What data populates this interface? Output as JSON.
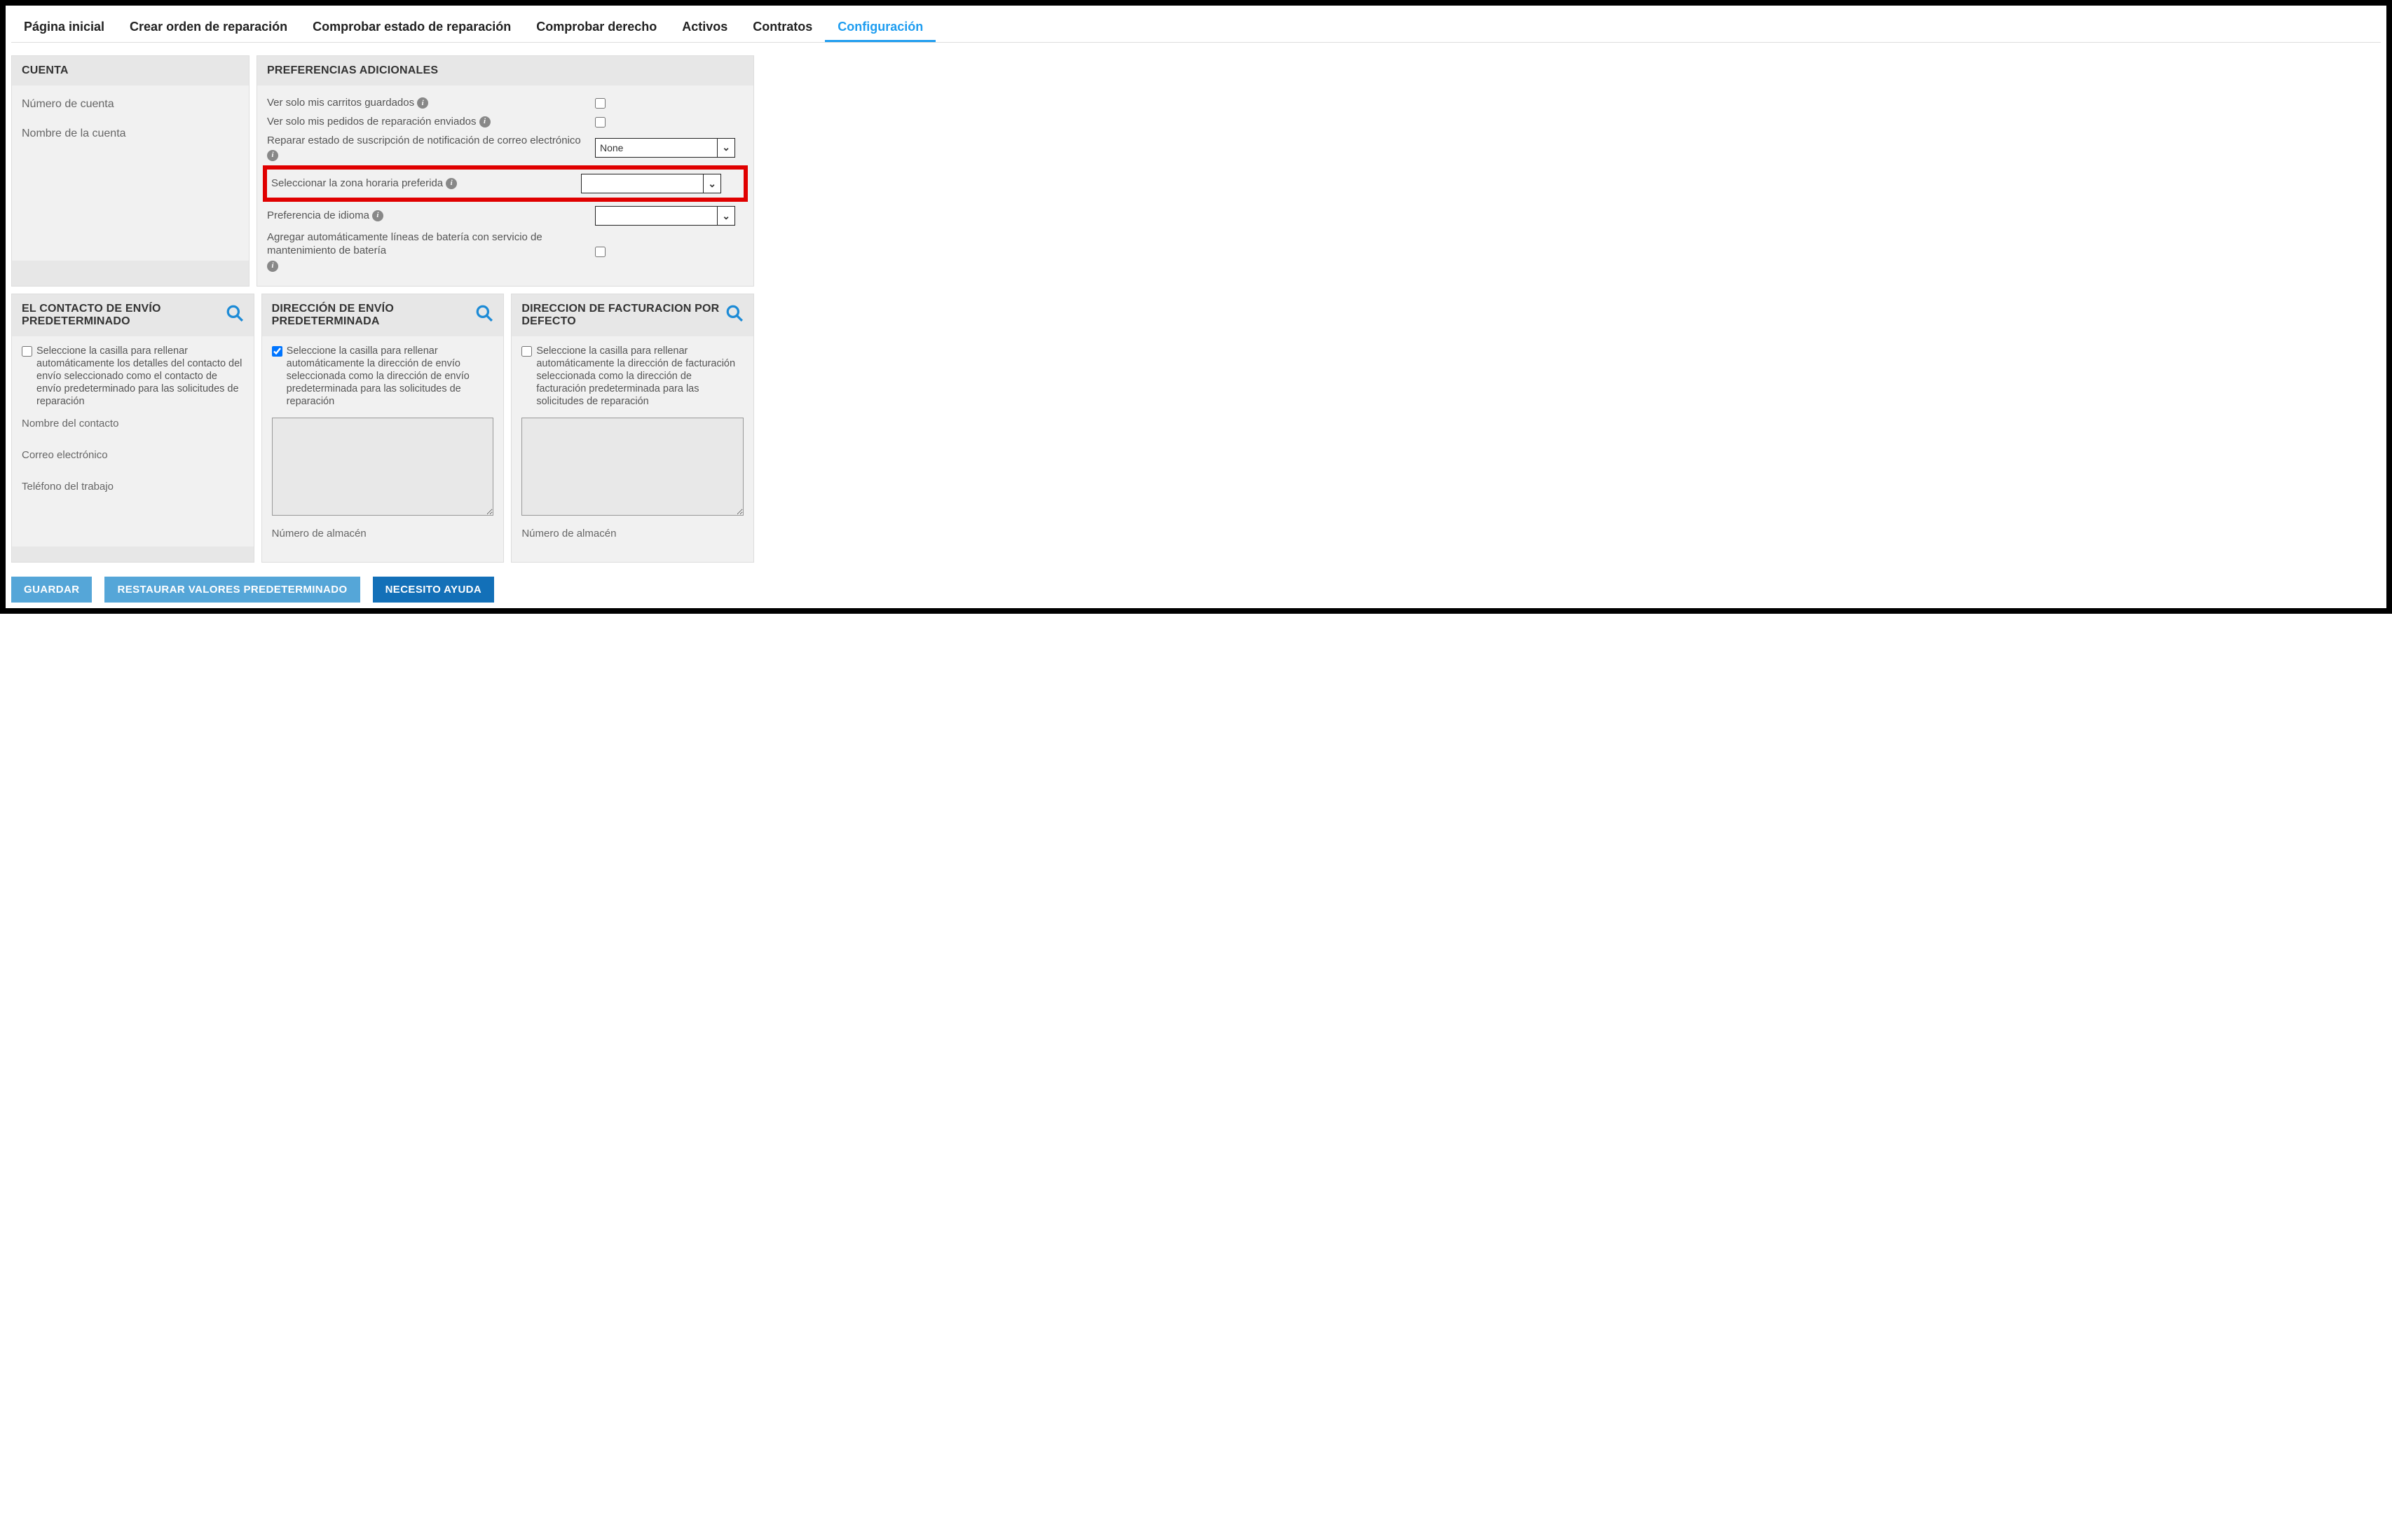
{
  "tabs": {
    "home": "Página inicial",
    "create": "Crear orden de reparación",
    "check_status": "Comprobar estado de reparación",
    "check_entitle": "Comprobar derecho",
    "assets": "Activos",
    "contracts": "Contratos",
    "config": "Configuración"
  },
  "account": {
    "title": "CUENTA",
    "number_label": "Número de cuenta",
    "name_label": "Nombre de la cuenta"
  },
  "prefs": {
    "title": "PREFERENCIAS ADICIONALES",
    "row1": "Ver solo mis carritos guardados",
    "row2": "Ver solo mis pedidos de reparación enviados",
    "row3": "Reparar estado de suscripción de notificación de correo electrónico",
    "row3_value": "None",
    "row4": "Seleccionar la zona horaria preferida",
    "row4_value": "",
    "row5": "Preferencia de idioma",
    "row5_value": "",
    "row6": "Agregar automáticamente líneas de batería con servicio de mantenimiento de batería"
  },
  "ship_contact": {
    "title": "EL CONTACTO DE ENVÍO PREDETERMINADO",
    "checkbox": "Seleccione la casilla para rellenar automáticamente los detalles del contacto del envío seleccionado como el contacto de envío predeterminado para las solicitudes de reparación",
    "contact_name": "Nombre del contacto",
    "email": "Correo electrónico",
    "phone": "Teléfono del trabajo"
  },
  "ship_addr": {
    "title": "DIRECCIÓN DE ENVÍO PREDETERMINADA",
    "checkbox": "Seleccione la casilla para rellenar automáticamente la dirección de envío seleccionada como la dirección de envío predeterminada para las solicitudes de reparación",
    "warehouse": "Número de almacén"
  },
  "bill_addr": {
    "title": "DIRECCION DE FACTURACION POR DEFECTO",
    "checkbox": "Seleccione la casilla para rellenar automáticamente la dirección de facturación seleccionada como la dirección de facturación predeterminada para las solicitudes de reparación",
    "warehouse": "Número de almacén"
  },
  "buttons": {
    "save": "GUARDAR",
    "restore": "RESTAURAR VALORES PREDETERMINADO",
    "help": "NECESITO AYUDA"
  }
}
